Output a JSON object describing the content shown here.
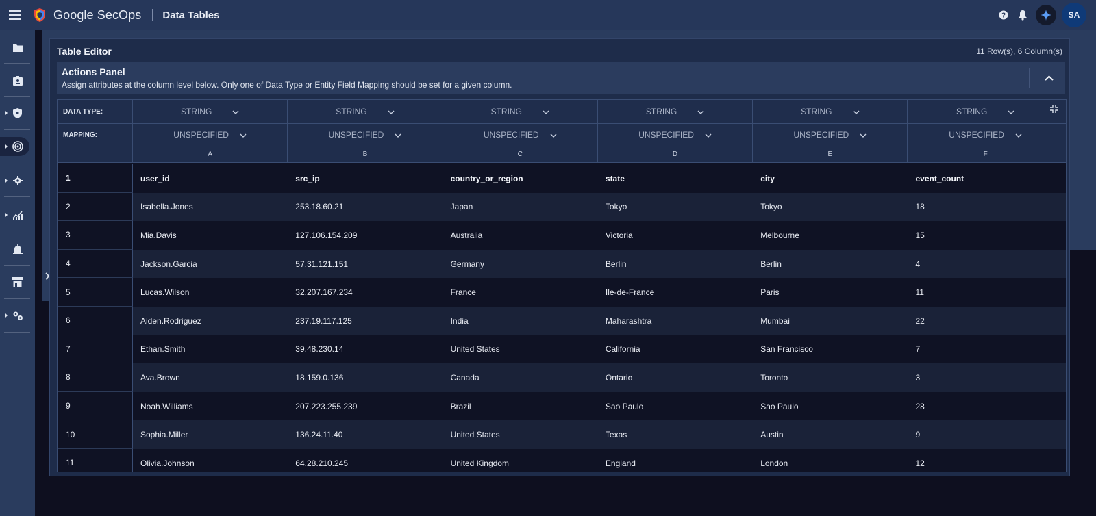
{
  "topbar": {
    "brand": "Google SecOps",
    "page": "Data Tables",
    "avatar": "SA"
  },
  "sidebar": {
    "items": [
      {
        "icon": "folder-icon",
        "caret": false
      },
      {
        "icon": "id-badge-icon",
        "caret": false
      },
      {
        "icon": "shield-icon",
        "caret": true
      },
      {
        "icon": "radar-icon",
        "caret": true,
        "active": true
      },
      {
        "icon": "gear-icon",
        "caret": true
      },
      {
        "icon": "chart-icon",
        "caret": true
      },
      {
        "icon": "alarm-icon",
        "caret": false
      },
      {
        "icon": "store-icon",
        "caret": false
      },
      {
        "icon": "settings-gears-icon",
        "caret": true
      }
    ]
  },
  "editor": {
    "title": "Table Editor",
    "count": "11 Row(s), 6 Column(s)"
  },
  "actions": {
    "title": "Actions Panel",
    "description": "Assign attributes at the column level below. Only one of Data Type or Entity Field Mapping should be set for a given column."
  },
  "grid": {
    "data_type_label": "DATA TYPE:",
    "mapping_label": "MAPPING:",
    "data_types": [
      "STRING",
      "STRING",
      "STRING",
      "STRING",
      "STRING",
      "STRING"
    ],
    "mappings": [
      "UNSPECIFIED",
      "UNSPECIFIED",
      "UNSPECIFIED",
      "UNSPECIFIED",
      "UNSPECIFIED",
      "UNSPECIFIED"
    ],
    "letters": [
      "A",
      "B",
      "C",
      "D",
      "E",
      "F"
    ],
    "rows": [
      {
        "n": "1",
        "cells": [
          "user_id",
          "src_ip",
          "country_or_region",
          "state",
          "city",
          "event_count"
        ]
      },
      {
        "n": "2",
        "cells": [
          "Isabella.Jones",
          "253.18.60.21",
          "Japan",
          "Tokyo",
          "Tokyo",
          "18"
        ]
      },
      {
        "n": "3",
        "cells": [
          "Mia.Davis",
          "127.106.154.209",
          "Australia",
          "Victoria",
          "Melbourne",
          "15"
        ]
      },
      {
        "n": "4",
        "cells": [
          "Jackson.Garcia",
          "57.31.121.151",
          "Germany",
          "Berlin",
          "Berlin",
          "4"
        ]
      },
      {
        "n": "5",
        "cells": [
          "Lucas.Wilson",
          "32.207.167.234",
          "France",
          "Ile-de-France",
          "Paris",
          "11"
        ]
      },
      {
        "n": "6",
        "cells": [
          "Aiden.Rodriguez",
          "237.19.117.125",
          "India",
          "Maharashtra",
          "Mumbai",
          "22"
        ]
      },
      {
        "n": "7",
        "cells": [
          "Ethan.Smith",
          "39.48.230.14",
          "United States",
          "California",
          "San Francisco",
          "7"
        ]
      },
      {
        "n": "8",
        "cells": [
          "Ava.Brown",
          "18.159.0.136",
          "Canada",
          "Ontario",
          "Toronto",
          "3"
        ]
      },
      {
        "n": "9",
        "cells": [
          "Noah.Williams",
          "207.223.255.239",
          "Brazil",
          "Sao Paulo",
          "Sao Paulo",
          "28"
        ]
      },
      {
        "n": "10",
        "cells": [
          "Sophia.Miller",
          "136.24.11.40",
          "United States",
          "Texas",
          "Austin",
          "9"
        ]
      },
      {
        "n": "11",
        "cells": [
          "Olivia.Johnson",
          "64.28.210.245",
          "United Kingdom",
          "England",
          "London",
          "12"
        ]
      }
    ]
  }
}
